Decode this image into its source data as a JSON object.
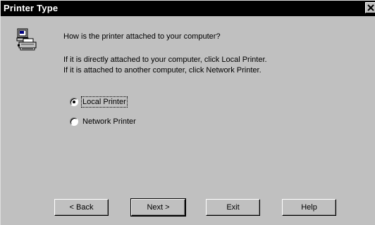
{
  "window": {
    "title": "Printer Type",
    "close_glyph": "×"
  },
  "content": {
    "question": "How is the printer attached to your computer?",
    "line1": "If it is directly attached to your computer, click Local Printer.",
    "line2": "If it is attached to another computer, click Network Printer."
  },
  "options": {
    "local": {
      "label": "Local Printer",
      "selected": true
    },
    "network": {
      "label": "Network Printer",
      "selected": false
    }
  },
  "buttons": {
    "back": "< Back",
    "next": "Next >",
    "exit": "Exit",
    "help": "Help"
  },
  "icons": {
    "printer": "printer-icon",
    "close": "close-icon"
  }
}
